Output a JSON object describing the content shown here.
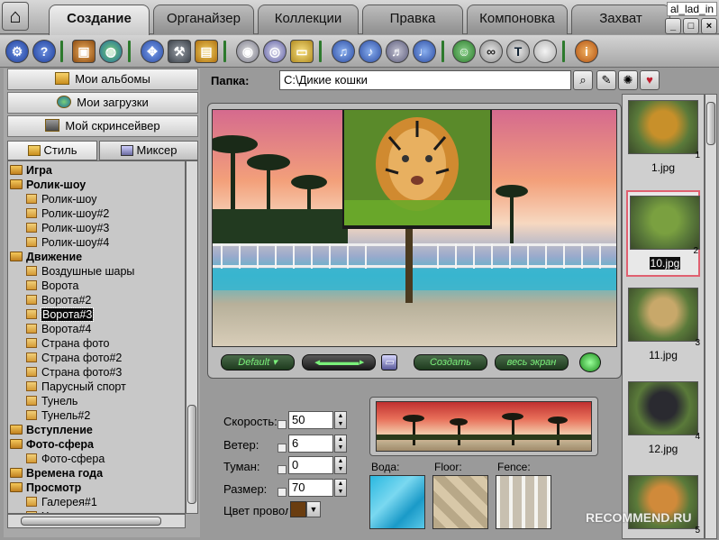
{
  "user_tag": "al_lad_in",
  "tabs": [
    {
      "label": "Создание",
      "active": true
    },
    {
      "label": "Органайзер",
      "active": false
    },
    {
      "label": "Коллекции",
      "active": false
    },
    {
      "label": "Правка",
      "active": false
    },
    {
      "label": "Компоновка",
      "active": false
    },
    {
      "label": "Захват",
      "active": false
    }
  ],
  "toolbar_icons": [
    "settings-icon",
    "help-icon",
    "camera-icon",
    "globe-icon",
    "fit-icon",
    "tools-icon",
    "film-icon",
    "cd-icon",
    "cd-edit-icon",
    "folder-icon",
    "music-icon",
    "music2-icon",
    "music3-icon",
    "music-off-icon",
    "user-icon",
    "link-icon",
    "text-icon",
    "blank-icon",
    "info-icon"
  ],
  "albums": {
    "my_albums": "Мои альбомы",
    "my_downloads": "Мои загрузки",
    "my_screensaver": "Мой скринсейвер"
  },
  "subtabs": {
    "style": "Стиль",
    "mixer": "Миксер"
  },
  "tree": [
    {
      "label": "Игра",
      "kind": "folder",
      "bold": true,
      "indent": 0
    },
    {
      "label": "Ролик-шоу",
      "kind": "folder",
      "bold": true,
      "indent": 0
    },
    {
      "label": "Ролик-шоу",
      "kind": "item",
      "indent": 1
    },
    {
      "label": "Ролик-шоу#2",
      "kind": "item",
      "indent": 1
    },
    {
      "label": "Ролик-шоу#3",
      "kind": "item",
      "indent": 1
    },
    {
      "label": "Ролик-шоу#4",
      "kind": "item",
      "indent": 1
    },
    {
      "label": "Движение",
      "kind": "folder",
      "bold": true,
      "indent": 0
    },
    {
      "label": "Воздушные шары",
      "kind": "item",
      "indent": 1
    },
    {
      "label": "Ворота",
      "kind": "item",
      "indent": 1
    },
    {
      "label": "Ворота#2",
      "kind": "item",
      "indent": 1
    },
    {
      "label": "Ворота#3",
      "kind": "item",
      "indent": 1,
      "selected": true
    },
    {
      "label": "Ворота#4",
      "kind": "item",
      "indent": 1
    },
    {
      "label": "Страна фото",
      "kind": "item",
      "indent": 1
    },
    {
      "label": "Страна фото#2",
      "kind": "item",
      "indent": 1
    },
    {
      "label": "Страна фото#3",
      "kind": "item",
      "indent": 1
    },
    {
      "label": "Парусный спорт",
      "kind": "item",
      "indent": 1
    },
    {
      "label": "Тунель",
      "kind": "item",
      "indent": 1
    },
    {
      "label": "Тунель#2",
      "kind": "item",
      "indent": 1
    },
    {
      "label": "Вступление",
      "kind": "folder",
      "bold": true,
      "indent": 0
    },
    {
      "label": "Фото-сфера",
      "kind": "folder",
      "bold": true,
      "indent": 0
    },
    {
      "label": "Фото-сфера",
      "kind": "item",
      "indent": 1
    },
    {
      "label": "Времена года",
      "kind": "folder",
      "bold": true,
      "indent": 0
    },
    {
      "label": "Просмотр",
      "kind": "folder",
      "bold": true,
      "indent": 0
    },
    {
      "label": "Галерея#1",
      "kind": "item",
      "indent": 1
    },
    {
      "label": "Хэллоуин",
      "kind": "item",
      "indent": 1
    }
  ],
  "folder": {
    "label": "Папка:",
    "value": "C:\\Дикие кошки"
  },
  "controls": {
    "default": "Default",
    "create": "Создать",
    "fullscreen": "весь экран"
  },
  "thumbs": [
    {
      "caption": "1.jpg",
      "num": "1",
      "selected": false,
      "color": "#c8902a"
    },
    {
      "caption": "10.jpg",
      "num": "2",
      "selected": true,
      "color": "#7aa040"
    },
    {
      "caption": "11.jpg",
      "num": "3",
      "selected": false,
      "color": "#c8a86a"
    },
    {
      "caption": "12.jpg",
      "num": "4",
      "selected": false,
      "color": "#2a2a30"
    },
    {
      "caption": "",
      "num": "5",
      "selected": false,
      "color": "#d08a3a"
    }
  ],
  "params": {
    "speed_label": "Скорость:",
    "speed": "50",
    "wind_label": "Ветер:",
    "wind": "6",
    "fog_label": "Туман:",
    "fog": "0",
    "size_label": "Размер:",
    "size": "70",
    "wire_color_label": "Цвет провол",
    "wire_color": "#6a3d10"
  },
  "textures": {
    "water": "Вода:",
    "floor": "Floor:",
    "fence": "Fence:"
  },
  "watermark": "RECOMMEND.RU"
}
